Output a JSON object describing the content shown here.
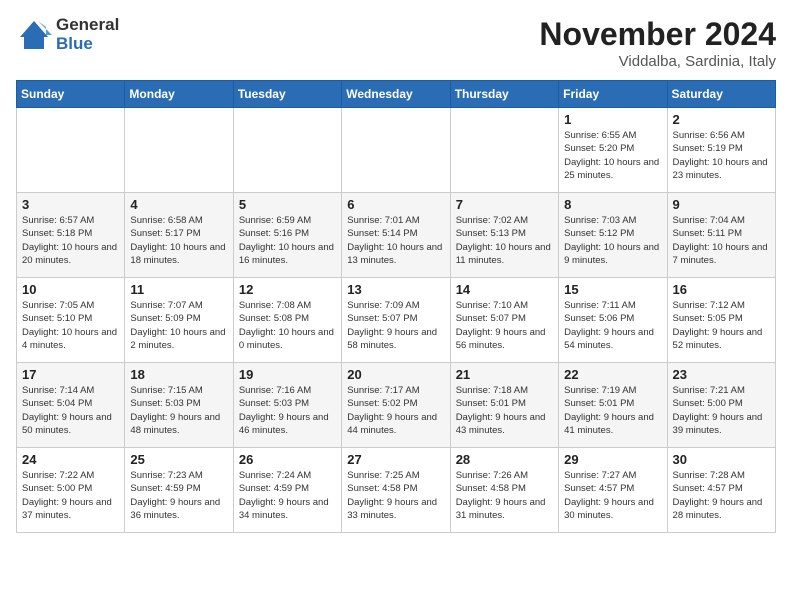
{
  "header": {
    "logo_general": "General",
    "logo_blue": "Blue",
    "title": "November 2024",
    "location": "Viddalba, Sardinia, Italy"
  },
  "days_of_week": [
    "Sunday",
    "Monday",
    "Tuesday",
    "Wednesday",
    "Thursday",
    "Friday",
    "Saturday"
  ],
  "weeks": [
    [
      {
        "day": "",
        "info": ""
      },
      {
        "day": "",
        "info": ""
      },
      {
        "day": "",
        "info": ""
      },
      {
        "day": "",
        "info": ""
      },
      {
        "day": "",
        "info": ""
      },
      {
        "day": "1",
        "info": "Sunrise: 6:55 AM\nSunset: 5:20 PM\nDaylight: 10 hours and 25 minutes."
      },
      {
        "day": "2",
        "info": "Sunrise: 6:56 AM\nSunset: 5:19 PM\nDaylight: 10 hours and 23 minutes."
      }
    ],
    [
      {
        "day": "3",
        "info": "Sunrise: 6:57 AM\nSunset: 5:18 PM\nDaylight: 10 hours and 20 minutes."
      },
      {
        "day": "4",
        "info": "Sunrise: 6:58 AM\nSunset: 5:17 PM\nDaylight: 10 hours and 18 minutes."
      },
      {
        "day": "5",
        "info": "Sunrise: 6:59 AM\nSunset: 5:16 PM\nDaylight: 10 hours and 16 minutes."
      },
      {
        "day": "6",
        "info": "Sunrise: 7:01 AM\nSunset: 5:14 PM\nDaylight: 10 hours and 13 minutes."
      },
      {
        "day": "7",
        "info": "Sunrise: 7:02 AM\nSunset: 5:13 PM\nDaylight: 10 hours and 11 minutes."
      },
      {
        "day": "8",
        "info": "Sunrise: 7:03 AM\nSunset: 5:12 PM\nDaylight: 10 hours and 9 minutes."
      },
      {
        "day": "9",
        "info": "Sunrise: 7:04 AM\nSunset: 5:11 PM\nDaylight: 10 hours and 7 minutes."
      }
    ],
    [
      {
        "day": "10",
        "info": "Sunrise: 7:05 AM\nSunset: 5:10 PM\nDaylight: 10 hours and 4 minutes."
      },
      {
        "day": "11",
        "info": "Sunrise: 7:07 AM\nSunset: 5:09 PM\nDaylight: 10 hours and 2 minutes."
      },
      {
        "day": "12",
        "info": "Sunrise: 7:08 AM\nSunset: 5:08 PM\nDaylight: 10 hours and 0 minutes."
      },
      {
        "day": "13",
        "info": "Sunrise: 7:09 AM\nSunset: 5:07 PM\nDaylight: 9 hours and 58 minutes."
      },
      {
        "day": "14",
        "info": "Sunrise: 7:10 AM\nSunset: 5:07 PM\nDaylight: 9 hours and 56 minutes."
      },
      {
        "day": "15",
        "info": "Sunrise: 7:11 AM\nSunset: 5:06 PM\nDaylight: 9 hours and 54 minutes."
      },
      {
        "day": "16",
        "info": "Sunrise: 7:12 AM\nSunset: 5:05 PM\nDaylight: 9 hours and 52 minutes."
      }
    ],
    [
      {
        "day": "17",
        "info": "Sunrise: 7:14 AM\nSunset: 5:04 PM\nDaylight: 9 hours and 50 minutes."
      },
      {
        "day": "18",
        "info": "Sunrise: 7:15 AM\nSunset: 5:03 PM\nDaylight: 9 hours and 48 minutes."
      },
      {
        "day": "19",
        "info": "Sunrise: 7:16 AM\nSunset: 5:03 PM\nDaylight: 9 hours and 46 minutes."
      },
      {
        "day": "20",
        "info": "Sunrise: 7:17 AM\nSunset: 5:02 PM\nDaylight: 9 hours and 44 minutes."
      },
      {
        "day": "21",
        "info": "Sunrise: 7:18 AM\nSunset: 5:01 PM\nDaylight: 9 hours and 43 minutes."
      },
      {
        "day": "22",
        "info": "Sunrise: 7:19 AM\nSunset: 5:01 PM\nDaylight: 9 hours and 41 minutes."
      },
      {
        "day": "23",
        "info": "Sunrise: 7:21 AM\nSunset: 5:00 PM\nDaylight: 9 hours and 39 minutes."
      }
    ],
    [
      {
        "day": "24",
        "info": "Sunrise: 7:22 AM\nSunset: 5:00 PM\nDaylight: 9 hours and 37 minutes."
      },
      {
        "day": "25",
        "info": "Sunrise: 7:23 AM\nSunset: 4:59 PM\nDaylight: 9 hours and 36 minutes."
      },
      {
        "day": "26",
        "info": "Sunrise: 7:24 AM\nSunset: 4:59 PM\nDaylight: 9 hours and 34 minutes."
      },
      {
        "day": "27",
        "info": "Sunrise: 7:25 AM\nSunset: 4:58 PM\nDaylight: 9 hours and 33 minutes."
      },
      {
        "day": "28",
        "info": "Sunrise: 7:26 AM\nSunset: 4:58 PM\nDaylight: 9 hours and 31 minutes."
      },
      {
        "day": "29",
        "info": "Sunrise: 7:27 AM\nSunset: 4:57 PM\nDaylight: 9 hours and 30 minutes."
      },
      {
        "day": "30",
        "info": "Sunrise: 7:28 AM\nSunset: 4:57 PM\nDaylight: 9 hours and 28 minutes."
      }
    ]
  ]
}
